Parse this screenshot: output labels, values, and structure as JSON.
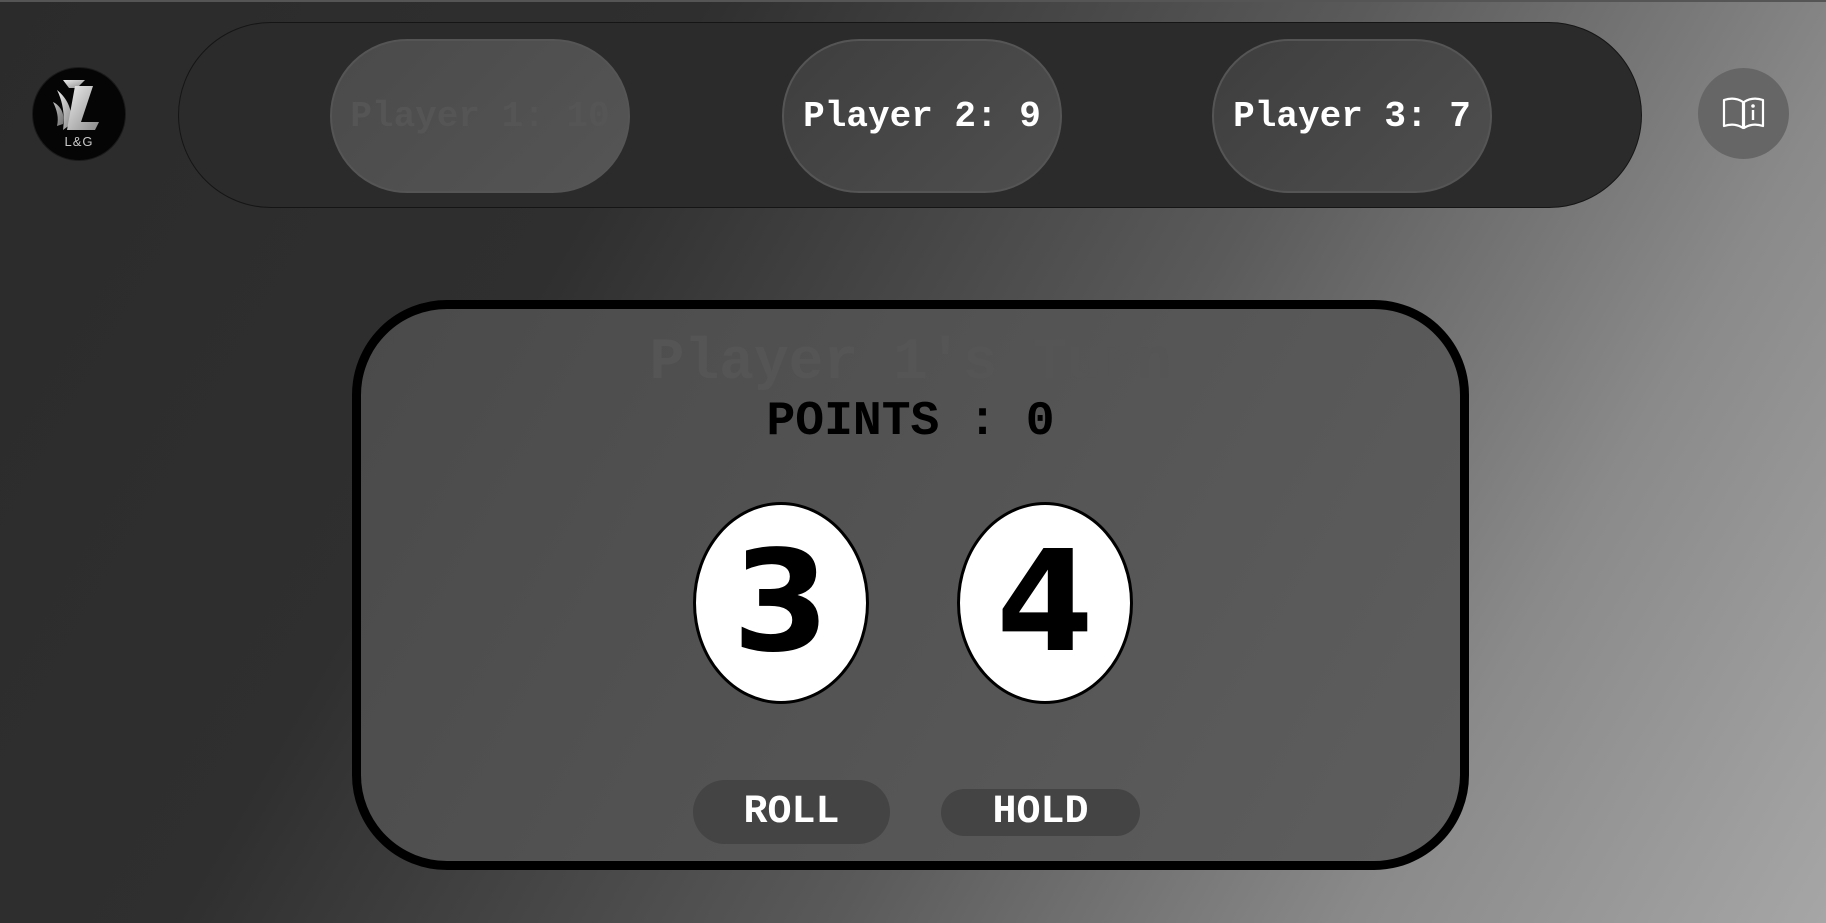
{
  "logo": {
    "text": "L&G",
    "icon": "lg-logo-icon"
  },
  "scoreboard": {
    "players": [
      {
        "label": "Player 1: 10",
        "active": true
      },
      {
        "label": "Player 2: 9",
        "active": false
      },
      {
        "label": "Player 3: 7",
        "active": false
      }
    ]
  },
  "info_button": {
    "icon": "book-info-icon"
  },
  "game": {
    "turn_title": "Player 1's Turn",
    "points_label": "POINTS : 0",
    "dice": [
      "3",
      "4"
    ],
    "roll_label": "ROLL",
    "hold_label": "HOLD"
  },
  "colors": {
    "card_border": "#000000",
    "die_face": "#ffffff",
    "button_bg": "#444444",
    "active_player_text": "#555555",
    "player_text": "#ffffff"
  }
}
